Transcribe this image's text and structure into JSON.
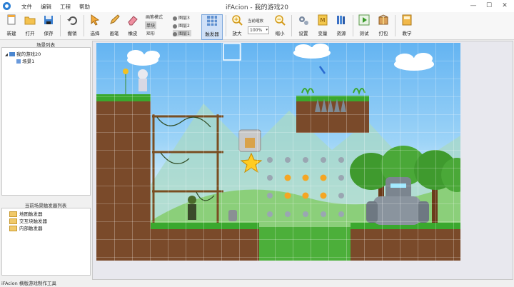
{
  "window": {
    "title": "iFAcion - 我的游戏20",
    "minimize": "—",
    "maximize": "☐",
    "close": "✕"
  },
  "menu": [
    "文件",
    "编辑",
    "工程",
    "帮助"
  ],
  "toolbar": {
    "new": "新建",
    "open": "打开",
    "save": "保存",
    "undo": "撤销",
    "select": "选择",
    "brush": "画笔",
    "eraser": "橡皮",
    "brush_mode": "画笔模式",
    "single": "单块",
    "rect": "矩形",
    "layer3": "图层3",
    "layer2": "图层2",
    "layer1": "图层1",
    "trigger": "触发器",
    "zoom_in": "放大",
    "zoom_label": "当前缩放",
    "zoom_value": "100%",
    "zoom_out": "缩小",
    "settings": "设置",
    "variables": "变量",
    "resources": "资源",
    "test": "测试",
    "package": "打包",
    "tutorial": "教学"
  },
  "scene_list": {
    "title": "场景列表",
    "root": "我的游戏20",
    "child": "场景1"
  },
  "trigger_list": {
    "title": "当前场景触发器列表",
    "items": [
      "地图触发器",
      "交互块触发器",
      "内部触发器"
    ]
  },
  "status": "iFAcion 横版游戏制作工具",
  "colors": {
    "accent": "#2b7fd4",
    "sky_top": "#64b4f2",
    "grass": "#3aa82e",
    "dirt": "#7a4a2a",
    "highlight": "#cfe0f7"
  }
}
